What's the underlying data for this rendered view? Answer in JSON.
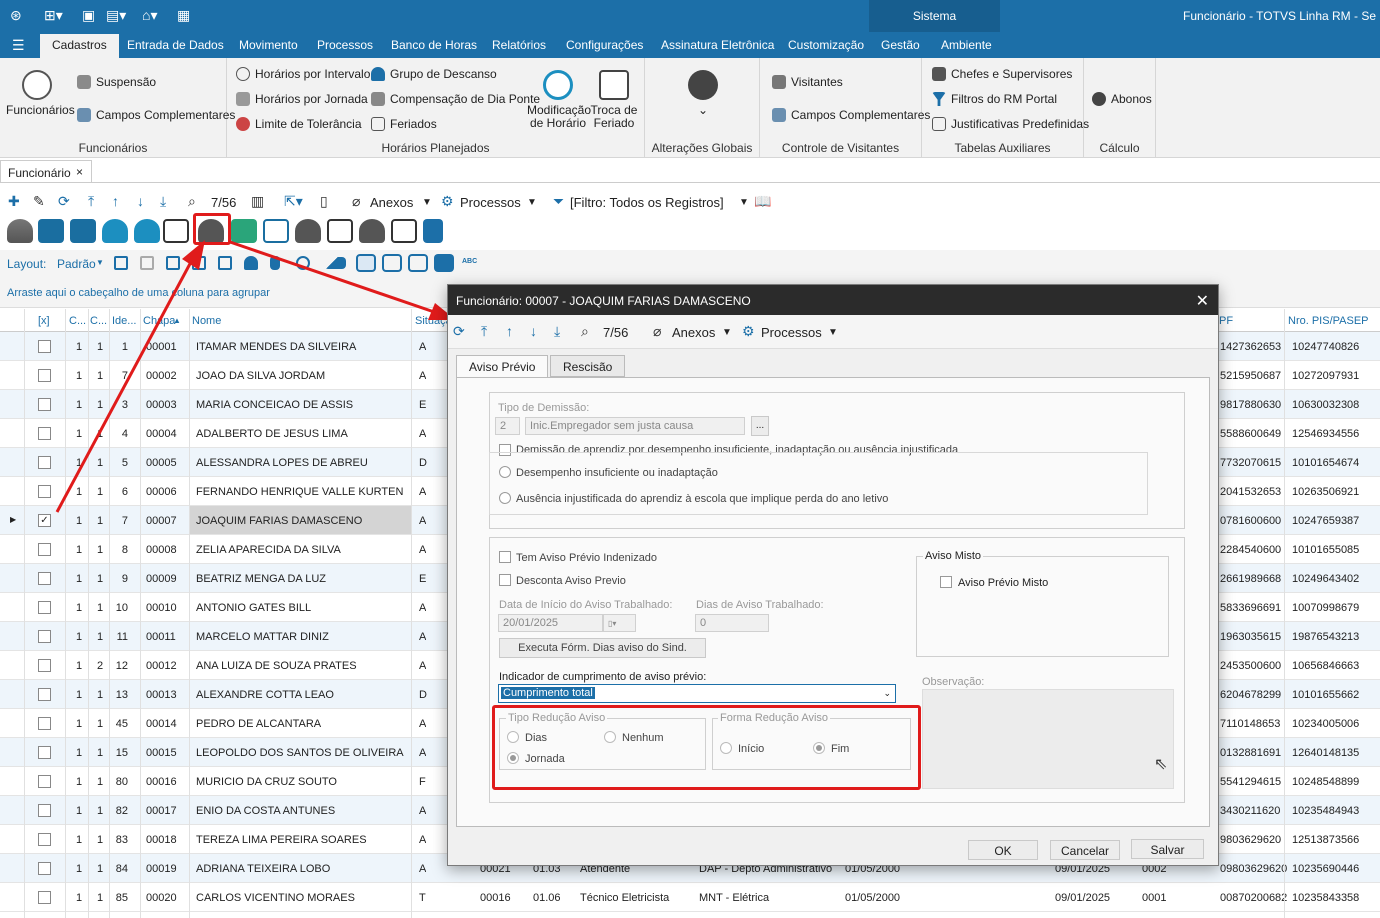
{
  "window": {
    "system_label": "Sistema",
    "app_title": "Funcionário - TOTVS Linha RM - Se"
  },
  "menu": [
    "Cadastros",
    "Entrada de Dados",
    "Movimento",
    "Processos",
    "Banco de Horas",
    "Relatórios",
    "Configurações",
    "Assinatura Eletrônica",
    "Customização",
    "Gestão",
    "Ambiente"
  ],
  "ribbon": {
    "funcionarios": {
      "big": "Funcionários",
      "suspensao": "Suspensão",
      "campos": "Campos Complementares",
      "group": "Funcionários"
    },
    "horarios": {
      "intervalo": "Horários por Intervalo",
      "jornada": "Horários por Jornada",
      "tolerancia": "Limite de Tolerância",
      "grupo": "Grupo de Descanso",
      "compensacao": "Compensação de Dia Ponte",
      "feriados": "Feriados",
      "modificacao": "Modificação de Horário",
      "troca": "Troca de Feriado",
      "group": "Horários Planejados"
    },
    "alteracoes": {
      "group": "Alterações Globais"
    },
    "visitantes": {
      "visitantes": "Visitantes",
      "campos": "Campos Complementares",
      "group": "Controle de Visitantes"
    },
    "tabelas": {
      "chefes": "Chefes e Supervisores",
      "filtros": "Filtros do RM Portal",
      "justificativas": "Justificativas Predefinidas",
      "group": "Tabelas Auxiliares"
    },
    "calculo": {
      "abonos": "Abonos",
      "group": "Cálculo"
    }
  },
  "doctab": {
    "label": "Funcionário",
    "close": "×"
  },
  "toolbar": {
    "count": "7/56",
    "anexos": "Anexos",
    "processos": "Processos",
    "filtro": "[Filtro: Todos os Registros]"
  },
  "layout": {
    "label": "Layout:",
    "value": "Padrão"
  },
  "group_hint": "Arraste aqui o cabeçalho de uma coluna para agrupar",
  "grid": {
    "headers": {
      "sel": "[x]",
      "c1": "C...",
      "c2": "C...",
      "ide": "Ide...",
      "chapa": "Chapa",
      "nome": "Nome",
      "situacao": "Situaçã",
      "cpf": "PF",
      "pis": "Nro. PIS/PASEP"
    },
    "rows": [
      {
        "c1": "1",
        "c2": "1",
        "id": "1",
        "chapa": "00001",
        "nome": "ITAMAR MENDES DA SILVEIRA",
        "sit": "A",
        "cpf": "1427362653",
        "pis": "10247740826"
      },
      {
        "c1": "1",
        "c2": "1",
        "id": "7",
        "chapa": "00002",
        "nome": "JOAO DA SILVA JORDAM",
        "sit": "A",
        "cpf": "5215950687",
        "pis": "10272097931"
      },
      {
        "c1": "1",
        "c2": "1",
        "id": "3",
        "chapa": "00003",
        "nome": "MARIA CONCEICAO DE ASSIS",
        "sit": "E",
        "cpf": "9817880630",
        "pis": "10630032308"
      },
      {
        "c1": "1",
        "c2": "1",
        "id": "4",
        "chapa": "00004",
        "nome": "ADALBERTO DE JESUS LIMA",
        "sit": "A",
        "cpf": "5588600649",
        "pis": "12546934556"
      },
      {
        "c1": "1",
        "c2": "1",
        "id": "5",
        "chapa": "00005",
        "nome": "ALESSANDRA LOPES DE ABREU",
        "sit": "D",
        "cpf": "7732070615",
        "pis": "10101654674"
      },
      {
        "c1": "1",
        "c2": "1",
        "id": "6",
        "chapa": "00006",
        "nome": "FERNANDO HENRIQUE VALLE KURTEN",
        "sit": "A",
        "cpf": "2041532653",
        "pis": "10263506921"
      },
      {
        "c1": "1",
        "c2": "1",
        "id": "7",
        "chapa": "00007",
        "nome": "JOAQUIM FARIAS DAMASCENO",
        "sit": "A",
        "cpf": "0781600600",
        "pis": "10247659387"
      },
      {
        "c1": "1",
        "c2": "1",
        "id": "8",
        "chapa": "00008",
        "nome": "ZELIA APARECIDA DA SILVA",
        "sit": "A",
        "cpf": "2284540600",
        "pis": "10101655085"
      },
      {
        "c1": "1",
        "c2": "1",
        "id": "9",
        "chapa": "00009",
        "nome": "BEATRIZ MENGA DA LUZ",
        "sit": "E",
        "cpf": "2661989668",
        "pis": "10249643402"
      },
      {
        "c1": "1",
        "c2": "1",
        "id": "10",
        "chapa": "00010",
        "nome": "ANTONIO GATES BILL",
        "sit": "A",
        "cpf": "5833696691",
        "pis": "10070998679"
      },
      {
        "c1": "1",
        "c2": "1",
        "id": "11",
        "chapa": "00011",
        "nome": "MARCELO MATTAR DINIZ",
        "sit": "A",
        "cpf": "1963035615",
        "pis": "19876543213"
      },
      {
        "c1": "1",
        "c2": "2",
        "id": "12",
        "chapa": "00012",
        "nome": "ANA LUIZA  DE SOUZA PRATES",
        "sit": "A",
        "cpf": "2453500600",
        "pis": "10656846663"
      },
      {
        "c1": "1",
        "c2": "1",
        "id": "13",
        "chapa": "00013",
        "nome": "ALEXANDRE COTTA LEAO",
        "sit": "D",
        "cpf": "6204678299",
        "pis": "10101655662"
      },
      {
        "c1": "1",
        "c2": "1",
        "id": "45",
        "chapa": "00014",
        "nome": "PEDRO DE ALCANTARA",
        "sit": "A",
        "cpf": "7110148653",
        "pis": "10234005006"
      },
      {
        "c1": "1",
        "c2": "1",
        "id": "15",
        "chapa": "00015",
        "nome": "LEOPOLDO DOS SANTOS DE OLIVEIRA N...",
        "sit": "A",
        "cpf": "0132881691",
        "pis": "12640148135"
      },
      {
        "c1": "1",
        "c2": "1",
        "id": "80",
        "chapa": "00016",
        "nome": "MURICIO DA CRUZ SOUTO",
        "sit": "F",
        "cpf": "5541294615",
        "pis": "10248548899"
      },
      {
        "c1": "1",
        "c2": "1",
        "id": "82",
        "chapa": "00017",
        "nome": "ENIO DA COSTA ANTUNES",
        "sit": "A",
        "cpf": "3430211620",
        "pis": "10235484943"
      },
      {
        "c1": "1",
        "c2": "1",
        "id": "83",
        "chapa": "00018",
        "nome": "TEREZA LIMA PEREIRA SOARES",
        "sit": "A",
        "cpf": "9803629620",
        "pis": "12513873566"
      },
      {
        "c1": "1",
        "c2": "1",
        "id": "84",
        "chapa": "00019",
        "nome": "ADRIANA TEIXEIRA LOBO",
        "sit": "A",
        "cpf": "09803629620",
        "pis": "10235690446"
      },
      {
        "c1": "1",
        "c2": "1",
        "id": "85",
        "chapa": "00020",
        "nome": "CARLOS VICENTINO MORAES",
        "sit": "T",
        "cpf": "00870200682",
        "pis": "10235843358"
      }
    ],
    "extra_row19": [
      "00021",
      "01.03",
      "Atendente",
      "DAP - Depto Administrativo",
      "01/05/2000",
      "09/01/2025",
      "0002"
    ],
    "extra_row20": [
      "00016",
      "01.06",
      "Técnico Eletricista",
      "MNT - Elétrica",
      "01/05/2000",
      "09/01/2025",
      "0001"
    ]
  },
  "dialog": {
    "title": "Funcionário: 00007 - JOAQUIM FARIAS DAMASCENO",
    "count": "7/56",
    "anexos": "Anexos",
    "processos": "Processos",
    "tabs": [
      "Aviso Prévio",
      "Rescisão"
    ],
    "tipo_demissao_label": "Tipo de Demissão:",
    "tipo_code": "2",
    "tipo_desc": "Inic.Empregador sem justa causa",
    "tipo_btn": "...",
    "aprendiz": "Demissão de aprendiz por desempenho insuficiente, inadaptação ou ausência injustificada",
    "opt_desempenho": "Desempenho insuficiente ou inadaptação",
    "opt_ausencia": "Ausência injustificada do aprendiz à escola que implique perda do ano letivo",
    "indenizado": "Tem Aviso Prévio Indenizado",
    "desconta": "Desconta Aviso Previo",
    "data_inicio_label": "Data de Início do Aviso Trabalhado:",
    "data_inicio": "20/01/2025",
    "dias_label": "Dias de Aviso Trabalhado:",
    "dias": "0",
    "executa": "Executa Fórm. Dias aviso do Sind.",
    "aviso_misto_group": "Aviso Misto",
    "aviso_misto": "Aviso Prévio Misto",
    "indicador_label": "Indicador de cumprimento de aviso prévio:",
    "indicador": "Cumprimento total",
    "observacao": "Observação:",
    "tipo_reducao": "Tipo Redução Aviso",
    "dias_opt": "Dias",
    "nenhum": "Nenhum",
    "jornada": "Jornada",
    "forma_reducao": "Forma Redução Aviso",
    "inicio": "Início",
    "fim": "Fim",
    "ok": "OK",
    "cancelar": "Cancelar",
    "salvar": "Salvar"
  },
  "colors": {
    "accent": "#1c6fa8",
    "highlight": "#e01b1b"
  }
}
